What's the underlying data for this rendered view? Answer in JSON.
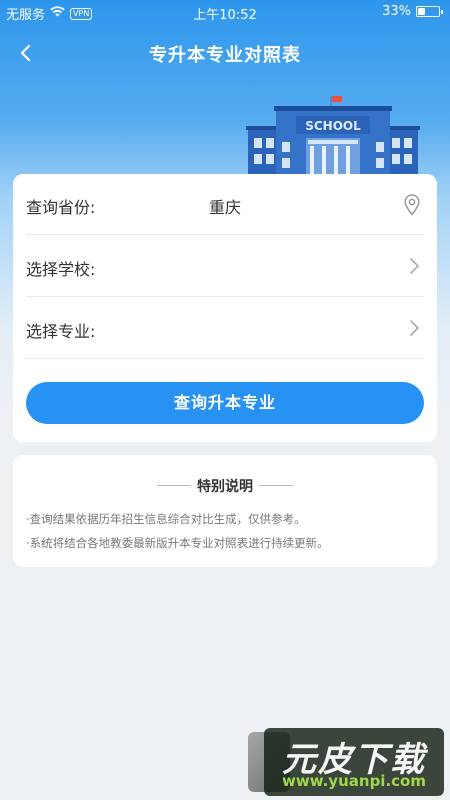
{
  "status_bar": {
    "carrier": "无服务",
    "vpn": "VPN",
    "time": "上午10:52",
    "battery_text": "33%",
    "battery_level": 0.33
  },
  "nav": {
    "title": "专升本专业对照表",
    "back_icon": "chevron-left-icon"
  },
  "illustration": {
    "sign_text": "SCHOOL"
  },
  "form": {
    "province": {
      "label": "查询省份:",
      "value": "重庆",
      "icon": "location-pin-icon"
    },
    "school": {
      "label": "选择学校:",
      "value": "",
      "icon": "chevron-right-icon"
    },
    "major": {
      "label": "选择专业:",
      "value": "",
      "icon": "chevron-right-icon"
    },
    "submit_label": "查询升本专业"
  },
  "notes": {
    "title": "特别说明",
    "items": [
      "·查询结果依据历年招生信息综合对比生成，仅供参考。",
      "·系统将结合各地教委最新版升本专业对照表进行持续更新。"
    ]
  },
  "watermark": {
    "text": "元皮下载",
    "url": "www.yuanpi.com"
  },
  "colors": {
    "primary": "#2792f3",
    "header_top": "#2d96ec",
    "background": "#eef1f4"
  }
}
